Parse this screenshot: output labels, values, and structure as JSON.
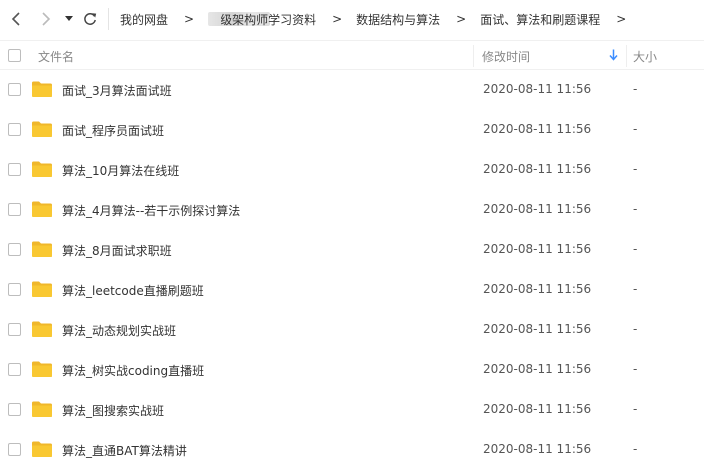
{
  "nav": {
    "back_icon": "chevron-left-icon",
    "forward_icon": "chevron-right-icon",
    "dropdown_icon": "caret-down-icon",
    "refresh_icon": "refresh-icon"
  },
  "breadcrumb": {
    "root": "我的网盘",
    "level1": "高级架构师学习资料",
    "level2": "数据结构与算法",
    "level3": "面试、算法和刷题课程",
    "separator": ">"
  },
  "table": {
    "columns": {
      "name": "文件名",
      "modified": "修改时间",
      "size": "大小"
    },
    "sort_icon": "sort-down-arrow-icon",
    "rows": [
      {
        "name": "面试_3月算法面试班",
        "modified": "2020-08-11 11:56",
        "size": "-"
      },
      {
        "name": "面试_程序员面试班",
        "modified": "2020-08-11 11:56",
        "size": "-"
      },
      {
        "name": "算法_10月算法在线班",
        "modified": "2020-08-11 11:56",
        "size": "-"
      },
      {
        "name": "算法_4月算法--若干示例探讨算法",
        "modified": "2020-08-11 11:56",
        "size": "-"
      },
      {
        "name": "算法_8月面试求职班",
        "modified": "2020-08-11 11:56",
        "size": "-"
      },
      {
        "name": "算法_leetcode直播刷题班",
        "modified": "2020-08-11 11:56",
        "size": "-"
      },
      {
        "name": "算法_动态规划实战班",
        "modified": "2020-08-11 11:56",
        "size": "-"
      },
      {
        "name": "算法_树实战coding直播班",
        "modified": "2020-08-11 11:56",
        "size": "-"
      },
      {
        "name": "算法_图搜索实战班",
        "modified": "2020-08-11 11:56",
        "size": "-"
      },
      {
        "name": "算法_直通BAT算法精讲",
        "modified": "2020-08-11 11:56",
        "size": "-"
      }
    ]
  },
  "colors": {
    "folder": "#f9c832",
    "folder_dark": "#f0b72a",
    "sort_arrow": "#3b8cff"
  }
}
